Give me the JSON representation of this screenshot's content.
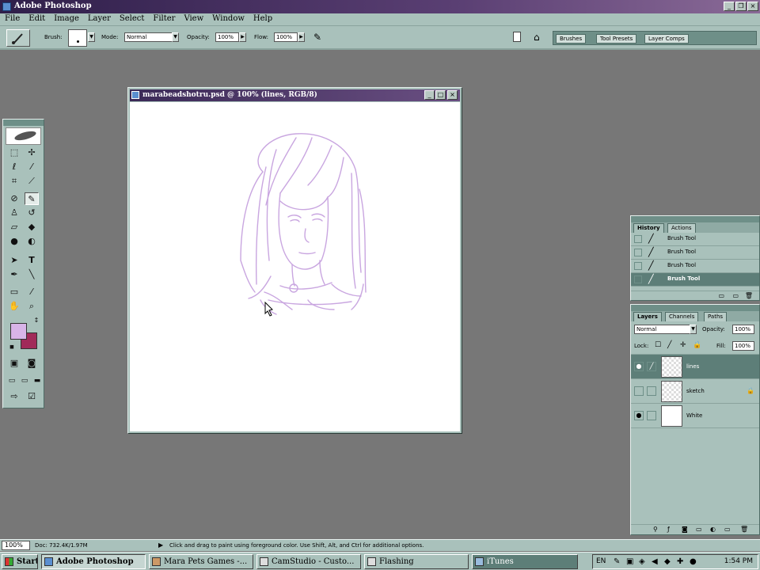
{
  "app": {
    "title": "Adobe Photoshop"
  },
  "menu": [
    "File",
    "Edit",
    "Image",
    "Layer",
    "Select",
    "Filter",
    "View",
    "Window",
    "Help"
  ],
  "options": {
    "brush_label": "Brush:",
    "mode_label": "Mode:",
    "mode_value": "Normal",
    "opacity_label": "Opacity:",
    "opacity_value": "100%",
    "flow_label": "Flow:",
    "flow_value": "100%"
  },
  "well_tabs": [
    "Brushes",
    "Tool Presets",
    "Layer Comps"
  ],
  "document": {
    "title": "marabeadshotru.psd @ 100% (lines, RGB/8)"
  },
  "swatches": {
    "foreground": "#d8b4e8",
    "background": "#a12a59"
  },
  "history": {
    "tabs": [
      "History",
      "Actions"
    ],
    "items": [
      "Brush Tool",
      "Brush Tool",
      "Brush Tool",
      "Brush Tool"
    ]
  },
  "layers": {
    "tabs": [
      "Layers",
      "Channels",
      "Paths"
    ],
    "blend_mode": "Normal",
    "opacity_label": "Opacity:",
    "opacity_value": "100%",
    "lock_label": "Lock:",
    "fill_label": "Fill:",
    "fill_value": "100%",
    "items": [
      "lines",
      "sketch",
      "White"
    ]
  },
  "status": {
    "zoom": "100%",
    "doc": "Doc: 732.4K/1.97M",
    "hint": "Click and drag to paint using foreground color. Use Shift, Alt, and Ctrl for additional options."
  },
  "taskbar": {
    "start": "Start",
    "items": [
      "Adobe Photoshop",
      "Mara Pets Games -...",
      "CamStudio - Custo...",
      "Flashing",
      "iTunes"
    ],
    "tray_lang": "EN",
    "clock": "1:54 PM"
  },
  "colors": {
    "sketch_line": "#c9a6e0",
    "chrome": "#a9c1bb",
    "desktop": "#777777"
  }
}
